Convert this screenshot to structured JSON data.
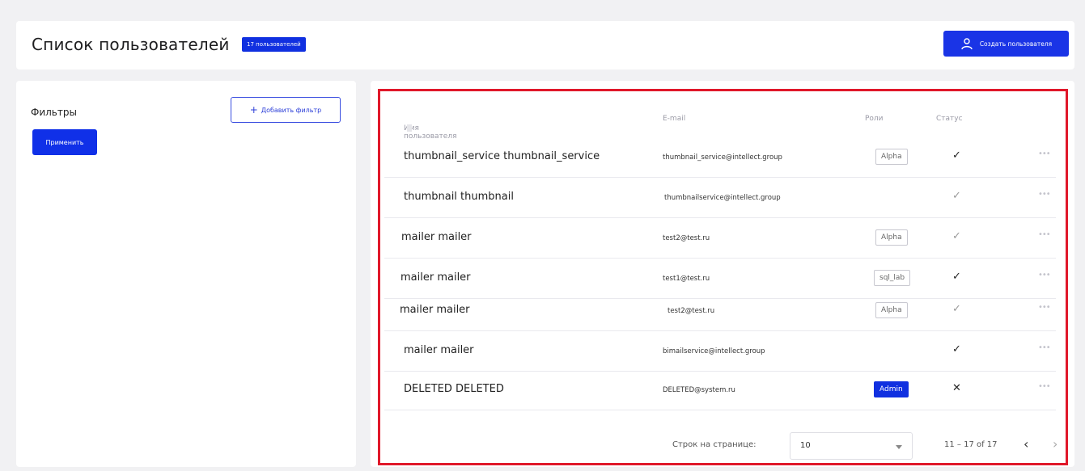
{
  "header": {
    "title": "Список пользователей",
    "count_badge": "17 пользователей",
    "create_button": "Создать пользователя"
  },
  "filters": {
    "title": "Фильтры",
    "add_filter": "Добавить фильтр",
    "apply": "Применить"
  },
  "table": {
    "columns": {
      "name": "Имя пользователя",
      "email": "E-mail",
      "role": "Роли",
      "status": "Статус"
    },
    "rows": [
      {
        "name": "thumbnail_service thumbnail_service",
        "email": "thumbnail_service@intellect.group",
        "role": "Alpha",
        "status": "✓"
      },
      {
        "name": "thumbnail thumbnail",
        "email": "thumbnailservice@intellect.group",
        "role": "",
        "status": "✓"
      },
      {
        "name": "mailer mailer",
        "email": "test2@test.ru",
        "role": "Alpha",
        "status": "✓"
      },
      {
        "name": "mailer mailer",
        "email": "test1@test.ru",
        "role": "sql_lab",
        "status": "✓"
      },
      {
        "name": "mailer mailer",
        "email": "test2@test.ru",
        "role": "Alpha",
        "status": "✓"
      },
      {
        "name": "mailer mailer",
        "email": "bimailservice@intellect.group",
        "role": "",
        "status": "✓"
      },
      {
        "name": "DELETED DELETED",
        "email": "DELETED@system.ru",
        "role": "Admin",
        "status": "✕"
      }
    ]
  },
  "pagination": {
    "rows_per_page_label": "Строк на странице:",
    "rows_per_page_value": "10",
    "range": "11 – 17 of 17",
    "prev": "‹",
    "next": "›"
  },
  "colors": {
    "accent": "#1030e0",
    "highlight": "#e0182a"
  }
}
